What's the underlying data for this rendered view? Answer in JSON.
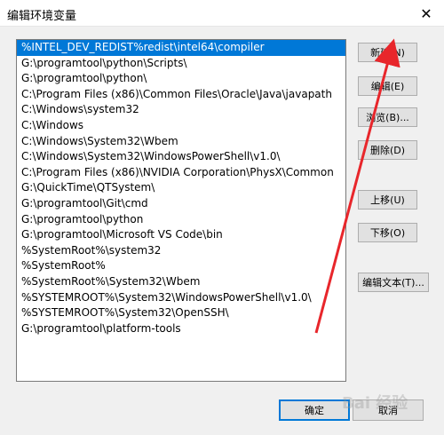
{
  "window": {
    "title": "编辑环境变量",
    "close_glyph": "✕"
  },
  "list": {
    "items": [
      "%INTEL_DEV_REDIST%redist\\intel64\\compiler",
      "G:\\programtool\\python\\Scripts\\",
      "G:\\programtool\\python\\",
      "C:\\Program Files (x86)\\Common Files\\Oracle\\Java\\javapath",
      "C:\\Windows\\system32",
      "C:\\Windows",
      "C:\\Windows\\System32\\Wbem",
      "C:\\Windows\\System32\\WindowsPowerShell\\v1.0\\",
      "C:\\Program Files (x86)\\NVIDIA Corporation\\PhysX\\Common",
      "G:\\QuickTime\\QTSystem\\",
      "G:\\programtool\\Git\\cmd",
      "G:\\programtool\\python",
      "G:\\programtool\\Microsoft VS Code\\bin",
      "%SystemRoot%\\system32",
      "%SystemRoot%",
      "%SystemRoot%\\System32\\Wbem",
      "%SYSTEMROOT%\\System32\\WindowsPowerShell\\v1.0\\",
      "%SYSTEMROOT%\\System32\\OpenSSH\\",
      "G:\\programtool\\platform-tools"
    ],
    "selected_index": 0
  },
  "buttons": {
    "new": "新建(N)",
    "edit": "编辑(E)",
    "browse": "浏览(B)...",
    "delete": "删除(D)",
    "move_up": "上移(U)",
    "move_down": "下移(O)",
    "edit_text": "编辑文本(T)...",
    "ok": "确定",
    "cancel": "取消"
  },
  "colors": {
    "selection": "#0078d7",
    "annotation_arrow": "#e8262b"
  },
  "watermark": "Bai 经验"
}
